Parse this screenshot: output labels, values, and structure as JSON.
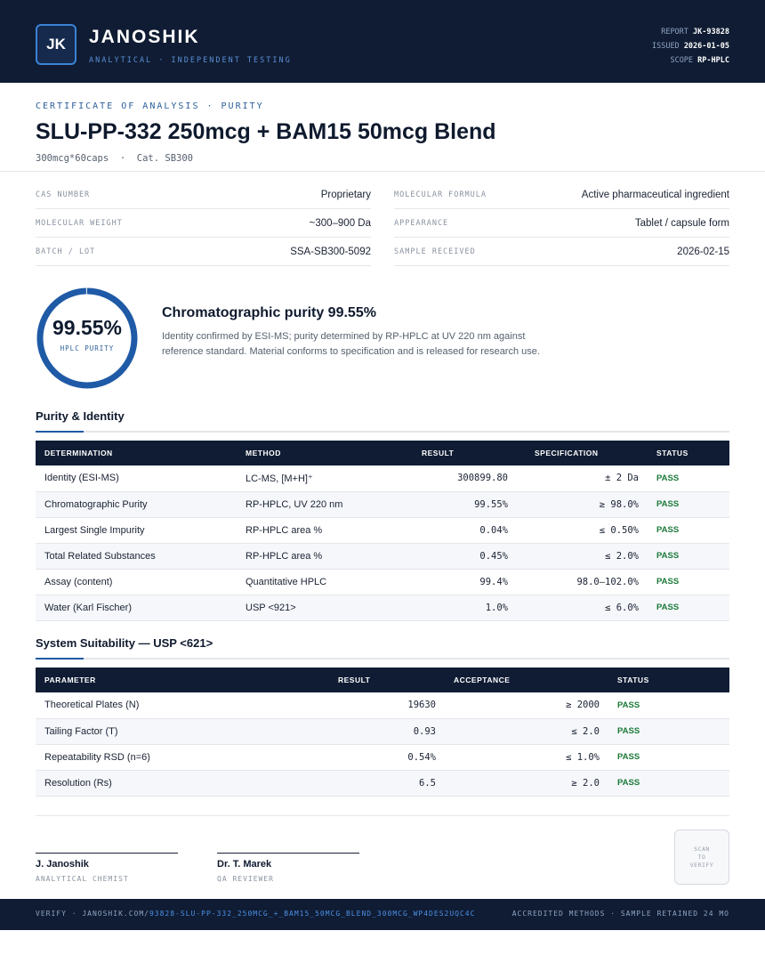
{
  "header": {
    "logo_initials": "JK",
    "brand": "JANOSHIK",
    "tagline": "ANALYTICAL · INDEPENDENT TESTING",
    "report_label": "REPORT",
    "report_value": "JK-93828",
    "issued_label": "ISSUED",
    "issued_value": "2026-01-05",
    "scope_label": "SCOPE",
    "scope_value": "RP-HPLC"
  },
  "title_block": {
    "eyebrow": "CERTIFICATE OF ANALYSIS · PURITY",
    "title": "SLU-PP-332 250mcg + BAM15 50mcg Blend",
    "subtitle": "300mcg*60caps  ·  Cat. SB300"
  },
  "info": {
    "cas_label": "CAS NUMBER",
    "cas_value": "Proprietary",
    "formula_label": "MOLECULAR FORMULA",
    "formula_value": "Active pharmaceutical ingredient",
    "weight_label": "MOLECULAR WEIGHT",
    "weight_value": "~300–900 Da",
    "appearance_label": "APPEARANCE",
    "appearance_value": "Tablet / capsule form",
    "batch_label": "BATCH / LOT",
    "batch_value": "SSA-SB300-5092",
    "received_label": "SAMPLE RECEIVED",
    "received_value": "2026-02-15"
  },
  "purity": {
    "value": "99.55%",
    "percent": 99.55,
    "label": "HPLC PURITY",
    "heading": "Chromatographic purity 99.55%",
    "description": "Identity confirmed by ESI-MS; purity determined by RP-HPLC at UV 220 nm against reference standard. Material conforms to specification and is released for research use."
  },
  "purity_identity": {
    "title": "Purity & Identity",
    "headers": [
      "DETERMINATION",
      "METHOD",
      "RESULT",
      "SPECIFICATION",
      "STATUS"
    ],
    "rows": [
      {
        "determination": "Identity (ESI-MS)",
        "method": "LC-MS, [M+H]⁺",
        "result": "300899.80",
        "spec": "± 2 Da",
        "status": "PASS"
      },
      {
        "determination": "Chromatographic Purity",
        "method": "RP-HPLC, UV 220 nm",
        "result": "99.55%",
        "spec": "≥ 98.0%",
        "status": "PASS"
      },
      {
        "determination": "Largest Single Impurity",
        "method": "RP-HPLC area %",
        "result": "0.04%",
        "spec": "≤ 0.50%",
        "status": "PASS"
      },
      {
        "determination": "Total Related Substances",
        "method": "RP-HPLC area %",
        "result": "0.45%",
        "spec": "≤ 2.0%",
        "status": "PASS"
      },
      {
        "determination": "Assay (content)",
        "method": "Quantitative HPLC",
        "result": "99.4%",
        "spec": "98.0–102.0%",
        "status": "PASS"
      },
      {
        "determination": "Water (Karl Fischer)",
        "method": "USP <921>",
        "result": "1.0%",
        "spec": "≤ 6.0%",
        "status": "PASS"
      }
    ]
  },
  "system_suitability": {
    "title": "System Suitability — USP <621>",
    "headers": [
      "PARAMETER",
      "RESULT",
      "ACCEPTANCE",
      "STATUS"
    ],
    "rows": [
      {
        "parameter": "Theoretical Plates (N)",
        "result": "19630",
        "acceptance": "≥ 2000",
        "status": "PASS"
      },
      {
        "parameter": "Tailing Factor (T)",
        "result": "0.93",
        "acceptance": "≤ 2.0",
        "status": "PASS"
      },
      {
        "parameter": "Repeatability RSD (n=6)",
        "result": "0.54%",
        "acceptance": "≤ 1.0%",
        "status": "PASS"
      },
      {
        "parameter": "Resolution (Rs)",
        "result": "6.5",
        "acceptance": "≥ 2.0",
        "status": "PASS"
      }
    ]
  },
  "signatures": [
    {
      "name": "J. Janoshik",
      "role": "ANALYTICAL CHEMIST"
    },
    {
      "name": "Dr. T. Marek",
      "role": "QA REVIEWER"
    }
  ],
  "qr": {
    "line1": "SCAN",
    "line2": "TO",
    "line3": "VERIFY"
  },
  "footer": {
    "verify_prefix": "VERIFY · JANOSHIK.COM/",
    "verify_path": "93828-SLU-PP-332_250MCG_+_BAM15_50MCG_BLEND_300MCG_WP4DES2UQC4C",
    "right": "ACCREDITED METHODS · SAMPLE RETAINED 24 MO"
  },
  "colors": {
    "navy": "#0f1c33",
    "accent_blue": "#1f5aa6",
    "pass_green": "#1d7a3a"
  }
}
